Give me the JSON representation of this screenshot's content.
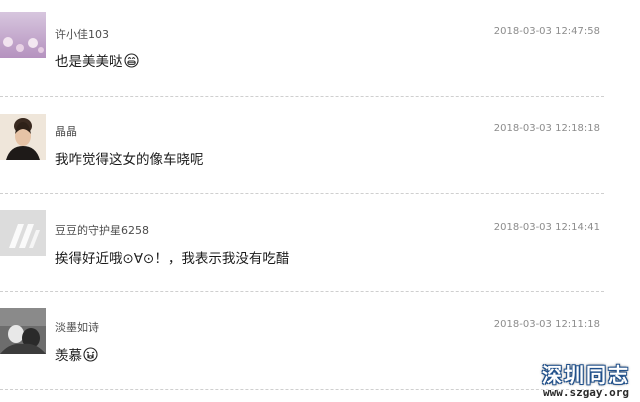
{
  "comments": [
    {
      "name": "许小佳103",
      "time": "2018-03-03 12:47:58",
      "text": "也是美美哒",
      "emoji": "grinning-emoji-icon"
    },
    {
      "name": "晶晶",
      "time": "2018-03-03 12:18:18",
      "text": "我咋觉得这女的像车晓呢"
    },
    {
      "name": "豆豆的守护星6258",
      "time": "2018-03-03 12:14:41",
      "text": "挨得好近哦⊙∀⊙！，我表示我没有吃醋"
    },
    {
      "name": "淡墨如诗",
      "time": "2018-03-03 12:11:18",
      "text": "羡慕",
      "emoji": "crying-emoji-icon"
    }
  ],
  "watermark": {
    "title": "深圳同志",
    "url": "www.szgay.org"
  },
  "colors": {
    "avatar_placeholder": "#dcdcdc",
    "divider": "#cfcfcf",
    "text": "#1a1a1a",
    "meta": "#8c8c8c"
  }
}
